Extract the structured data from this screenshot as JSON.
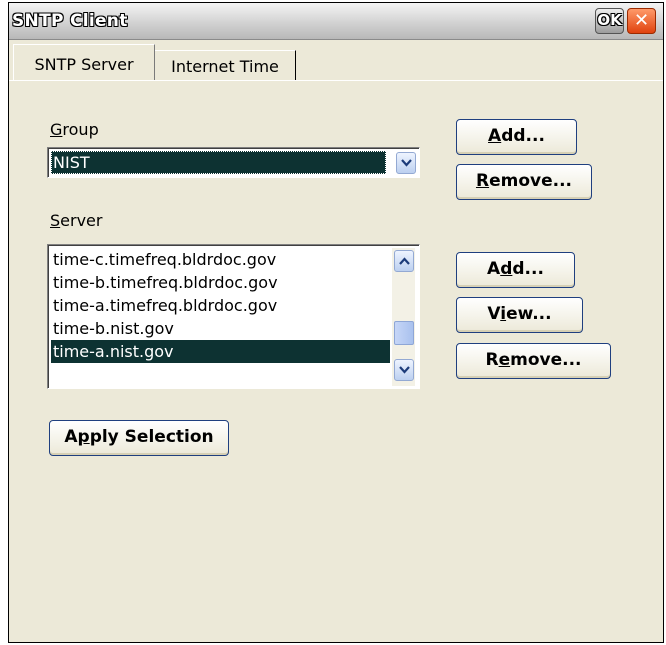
{
  "window": {
    "title": "SNTP Client",
    "ok_label": "OK",
    "close_glyph": "✕"
  },
  "tabs": [
    {
      "label": "SNTP Server",
      "active": true
    },
    {
      "label": "Internet Time",
      "active": false
    }
  ],
  "group": {
    "label_mnemonic": "G",
    "label_rest": "roup",
    "selected": "NIST",
    "add_mnemonic": "A",
    "add_rest": "dd...",
    "remove_mnemonic": "R",
    "remove_rest": "emove..."
  },
  "server": {
    "label_mnemonic": "S",
    "label_rest": "erver",
    "items": [
      "time-c.timefreq.bldrdoc.gov",
      "time-b.timefreq.bldrdoc.gov",
      "time-a.timefreq.bldrdoc.gov",
      "time-b.nist.gov",
      "time-a.nist.gov"
    ],
    "selected_index": 4,
    "add_pre": "A",
    "add_mnemonic": "d",
    "add_rest": "d...",
    "view_pre": "V",
    "view_mnemonic": "i",
    "view_rest": "ew...",
    "remove_pre": "R",
    "remove_mnemonic": "e",
    "remove_rest": "move..."
  },
  "apply": {
    "pre": "A",
    "mnemonic": "p",
    "rest": "ply Selection"
  },
  "icons": {
    "dropdown": "chevron-down-icon",
    "scroll_up": "chevron-up-icon",
    "scroll_down": "chevron-down-icon"
  },
  "colors": {
    "selection": "#0d3232",
    "dialog_bg": "#ece9d8",
    "button_border": "#1f3f7f",
    "close_button": "#e0420e"
  }
}
